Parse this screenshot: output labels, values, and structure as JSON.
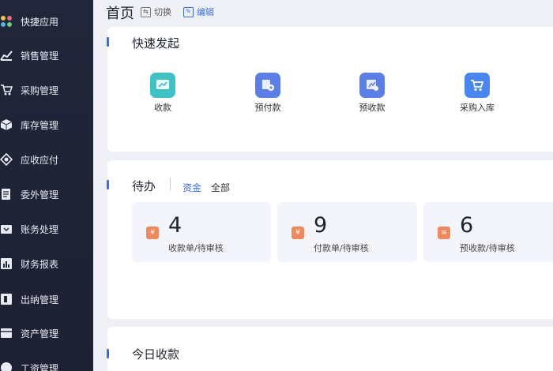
{
  "sidebar": {
    "items": [
      {
        "label": "快捷应用",
        "icon": "apps-icon"
      },
      {
        "label": "销售管理",
        "icon": "sales-chart-icon"
      },
      {
        "label": "采购管理",
        "icon": "cart-icon"
      },
      {
        "label": "库存管理",
        "icon": "box-icon"
      },
      {
        "label": "应收应付",
        "icon": "diamond-icon"
      },
      {
        "label": "委外管理",
        "icon": "document-icon"
      },
      {
        "label": "账务处理",
        "icon": "ledger-icon"
      },
      {
        "label": "财务报表",
        "icon": "report-icon"
      },
      {
        "label": "出纳管理",
        "icon": "cashier-icon"
      },
      {
        "label": "资产管理",
        "icon": "asset-icon"
      },
      {
        "label": "工资管理",
        "icon": "salary-icon"
      }
    ]
  },
  "header": {
    "title": "首页",
    "switch_label": "切换",
    "edit_label": "编辑"
  },
  "quick_start": {
    "title": "快速发起",
    "actions": [
      {
        "label": "收款",
        "icon": "receive-money-icon",
        "color": "#3fc2c4"
      },
      {
        "label": "预付款",
        "icon": "prepay-icon",
        "color": "#5b7fe6"
      },
      {
        "label": "预收款",
        "icon": "prereceive-icon",
        "color": "#5b7fe6"
      },
      {
        "label": "采购入库",
        "icon": "purchase-cart-icon",
        "color": "#4a86f0"
      }
    ]
  },
  "todo": {
    "title": "待办",
    "tabs": [
      {
        "label": "资金",
        "active": true
      },
      {
        "label": "全部",
        "active": false
      }
    ],
    "items": [
      {
        "count": "4",
        "label": "收款单/待审核",
        "icon": "yuan-icon"
      },
      {
        "count": "9",
        "label": "付款单/待审核",
        "icon": "yuan-icon"
      },
      {
        "count": "6",
        "label": "预收款/待审核",
        "icon": "bill-icon"
      }
    ]
  },
  "today_receipts": {
    "title": "今日收款"
  }
}
